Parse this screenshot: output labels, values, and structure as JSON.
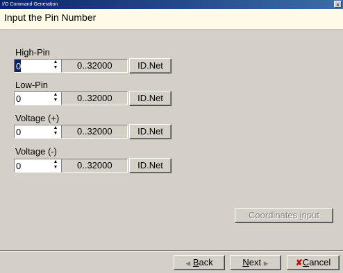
{
  "window": {
    "title": "I/O Command Generation",
    "close_glyph": "×"
  },
  "header": {
    "text": "Input the Pin Number"
  },
  "fields": [
    {
      "label": "High-Pin",
      "value": "0",
      "range": "0..32000",
      "button": "ID.Net"
    },
    {
      "label": "Low-Pin",
      "value": "0",
      "range": "0..32000",
      "button": "ID.Net"
    },
    {
      "label": "Voltage (+)",
      "value": "0",
      "range": "0..32000",
      "button": "ID.Net"
    },
    {
      "label": "Voltage (-)",
      "value": "0",
      "range": "0..32000",
      "button": "ID.Net"
    }
  ],
  "spin_glyphs": {
    "up": "▲",
    "down": "▼"
  },
  "coordinates_button": {
    "pre": "Coordinates ",
    "key": "i",
    "post": "nput",
    "enabled": false
  },
  "nav": {
    "back": {
      "arrow": "◀",
      "key": "B",
      "post": "ack"
    },
    "next": {
      "key": "N",
      "post": "ext",
      "arrow": "▶"
    },
    "cancel": {
      "icon": "✘",
      "key": "C",
      "post": "ancel"
    }
  }
}
